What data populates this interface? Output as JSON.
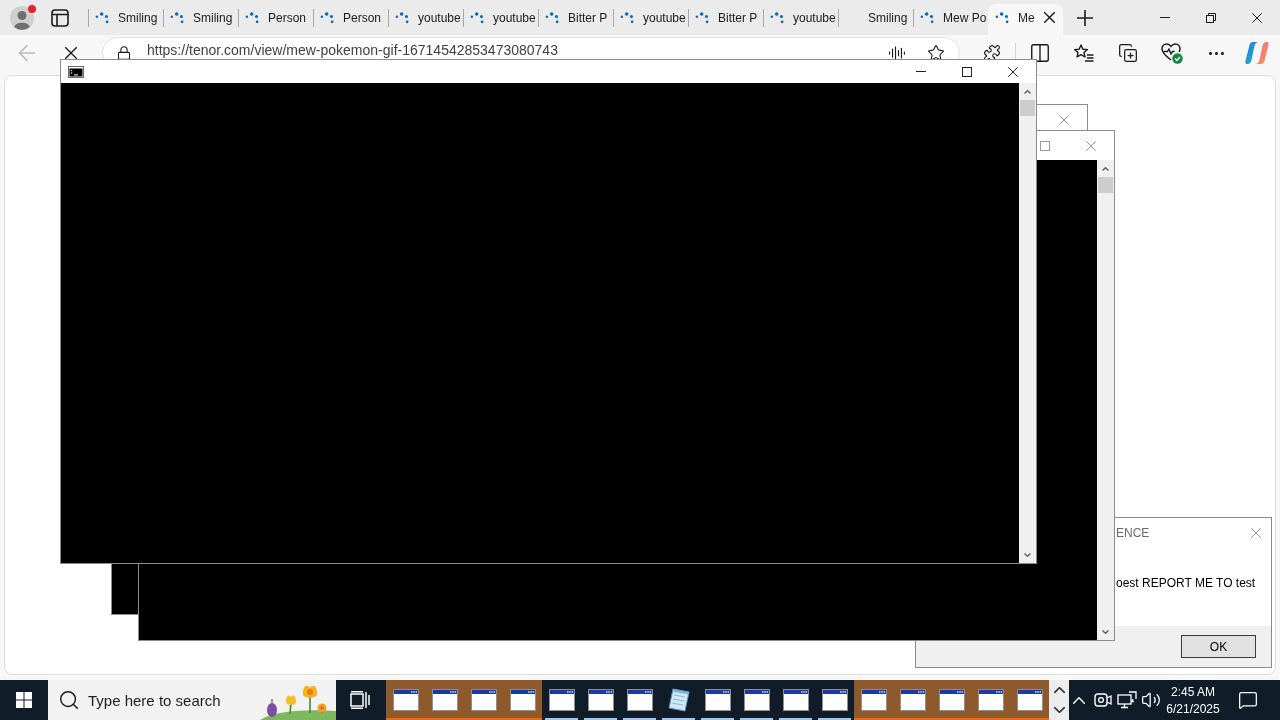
{
  "browser": {
    "profile": {
      "notification": true
    },
    "tabs": [
      {
        "title": "Smiling",
        "loading": true,
        "selected": false
      },
      {
        "title": "Smiling",
        "loading": true,
        "selected": false
      },
      {
        "title": "Person",
        "loading": true,
        "selected": false
      },
      {
        "title": "Person",
        "loading": true,
        "selected": false
      },
      {
        "title": "youtube",
        "loading": true,
        "selected": false
      },
      {
        "title": "youtube",
        "loading": true,
        "selected": false
      },
      {
        "title": "Bitter P",
        "loading": true,
        "selected": false
      },
      {
        "title": "youtube",
        "loading": true,
        "selected": false
      },
      {
        "title": "Bitter P",
        "loading": true,
        "selected": false
      },
      {
        "title": "youtube",
        "loading": true,
        "selected": false
      },
      {
        "title": "Smiling",
        "loading": false,
        "selected": false
      },
      {
        "title": "Mew Po",
        "loading": true,
        "selected": false
      },
      {
        "title": "Me",
        "loading": true,
        "selected": true
      }
    ],
    "back": {
      "disabled": true
    },
    "address_bar": {
      "url": "https://tenor.com/view/mew-pokemon-gif-16714542853473080743"
    }
  },
  "windows": [
    {
      "kind": "console",
      "active": true
    },
    {
      "kind": "console",
      "active": false
    },
    {
      "kind": "console",
      "active": false
    },
    {
      "kind": "message_box",
      "active": false,
      "title": "ENCE",
      "message": "oest REPORT ME TO test",
      "button": "OK"
    }
  ],
  "taskbar": {
    "search": {
      "placeholder": "Type here to search"
    },
    "apps": [
      {
        "kind": "window",
        "flashing": true
      },
      {
        "kind": "window",
        "flashing": true
      },
      {
        "kind": "window",
        "flashing": true
      },
      {
        "kind": "window",
        "flashing": true
      },
      {
        "kind": "window",
        "flashing": false
      },
      {
        "kind": "window",
        "flashing": false
      },
      {
        "kind": "window",
        "flashing": false
      },
      {
        "kind": "notepad",
        "flashing": false
      },
      {
        "kind": "window",
        "flashing": false
      },
      {
        "kind": "window",
        "flashing": false
      },
      {
        "kind": "window",
        "flashing": false
      },
      {
        "kind": "window",
        "flashing": false
      },
      {
        "kind": "window",
        "flashing": true
      },
      {
        "kind": "window",
        "flashing": true
      },
      {
        "kind": "window",
        "flashing": true
      },
      {
        "kind": "window",
        "flashing": true
      },
      {
        "kind": "window",
        "flashing": true
      }
    ],
    "clock": {
      "time": "2:45 AM",
      "date": "6/21/2025"
    }
  }
}
